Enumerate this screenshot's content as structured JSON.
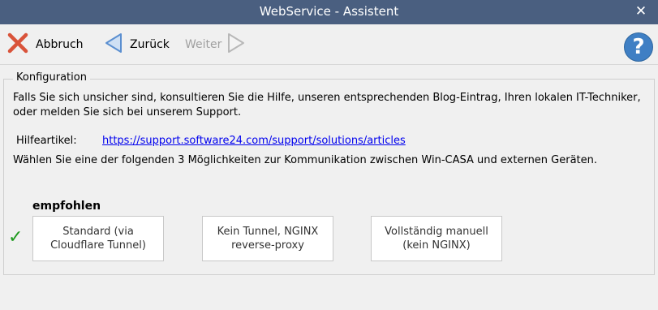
{
  "window": {
    "title": "WebService - Assistent",
    "close_glyph": "✕"
  },
  "toolbar": {
    "cancel_label": "Abbruch",
    "back_label": "Zurück",
    "next_label": "Weiter",
    "help_glyph": "?"
  },
  "content": {
    "group_title": "Konfiguration",
    "info_text": "Falls Sie sich unsicher sind, konsultieren Sie die Hilfe, unseren entsprechenden Blog-Eintrag, Ihren lokalen IT-Techniker, oder melden Sie sich bei unserem Support.",
    "help_article_label": "Hilfeartikel:",
    "help_article_url": "https://support.software24.com/support/solutions/articles",
    "choose_text": "Wählen Sie eine der folgenden 3 Möglichkeiten zur Kommunikation zwischen Win-CASA und externen Geräten.",
    "recommended_label": "empfohlen",
    "check_glyph": "✓",
    "options": [
      {
        "label": "Standard (via Cloudflare Tunnel)"
      },
      {
        "label": "Kein Tunnel, NGINX reverse-proxy"
      },
      {
        "label": "Vollständig manuell (kein NGINX)"
      }
    ]
  },
  "colors": {
    "titlebar": "#4a5f80",
    "link": "#0000ee",
    "check": "#1e9a1e",
    "help_button": "#3f7fc4",
    "cancel_icon": "#d9533a",
    "nav_arrow": "#5b8fd0"
  }
}
